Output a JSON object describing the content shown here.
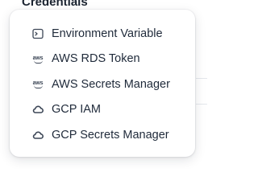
{
  "background": {
    "section_title": "Credentials"
  },
  "menu": {
    "items": [
      {
        "label": "Environment Variable",
        "icon": "terminal-icon"
      },
      {
        "label": "AWS RDS Token",
        "icon": "aws-icon"
      },
      {
        "label": "AWS Secrets Manager",
        "icon": "aws-icon"
      },
      {
        "label": "GCP IAM",
        "icon": "gcp-cloud-icon"
      },
      {
        "label": "GCP Secrets Manager",
        "icon": "gcp-cloud-icon"
      }
    ]
  },
  "colors": {
    "text": "#1f2a3a",
    "icon": "#3c4656",
    "menu_background": "#ffffff"
  }
}
